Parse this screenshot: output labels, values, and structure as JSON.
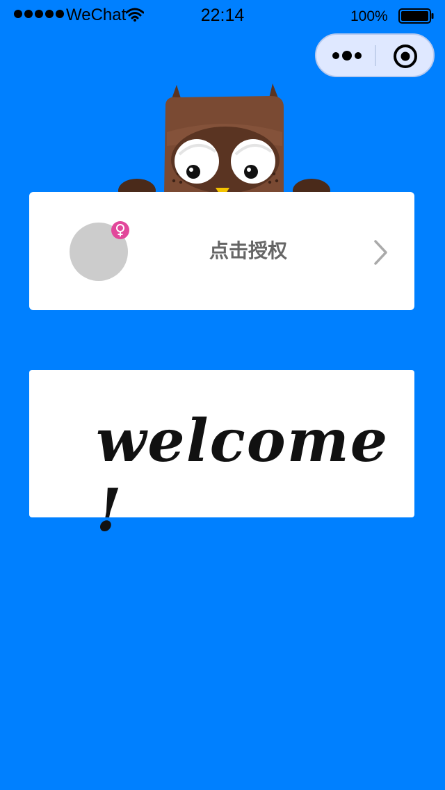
{
  "status_bar": {
    "carrier": "WeChat",
    "time": "22:14",
    "battery_percent": "100%",
    "signal_bars": 5,
    "icons": [
      "wifi-icon",
      "battery-icon"
    ]
  },
  "capsule": {
    "icons": [
      "more-icon",
      "close-icon"
    ]
  },
  "mascot": {
    "icon": "owl-icon"
  },
  "auth_card": {
    "label": "点击授权",
    "avatar_color": "#cccccc",
    "gender_badge_icon": "female-icon",
    "gender_badge_color": "#e2479b",
    "chevron_icon": "chevron-right-icon"
  },
  "welcome_card": {
    "text": "welcome !"
  },
  "colors": {
    "background": "#0080ff",
    "card": "#ffffff",
    "owl_body": "#7a4a33",
    "owl_feet": "#4a2a1a"
  }
}
